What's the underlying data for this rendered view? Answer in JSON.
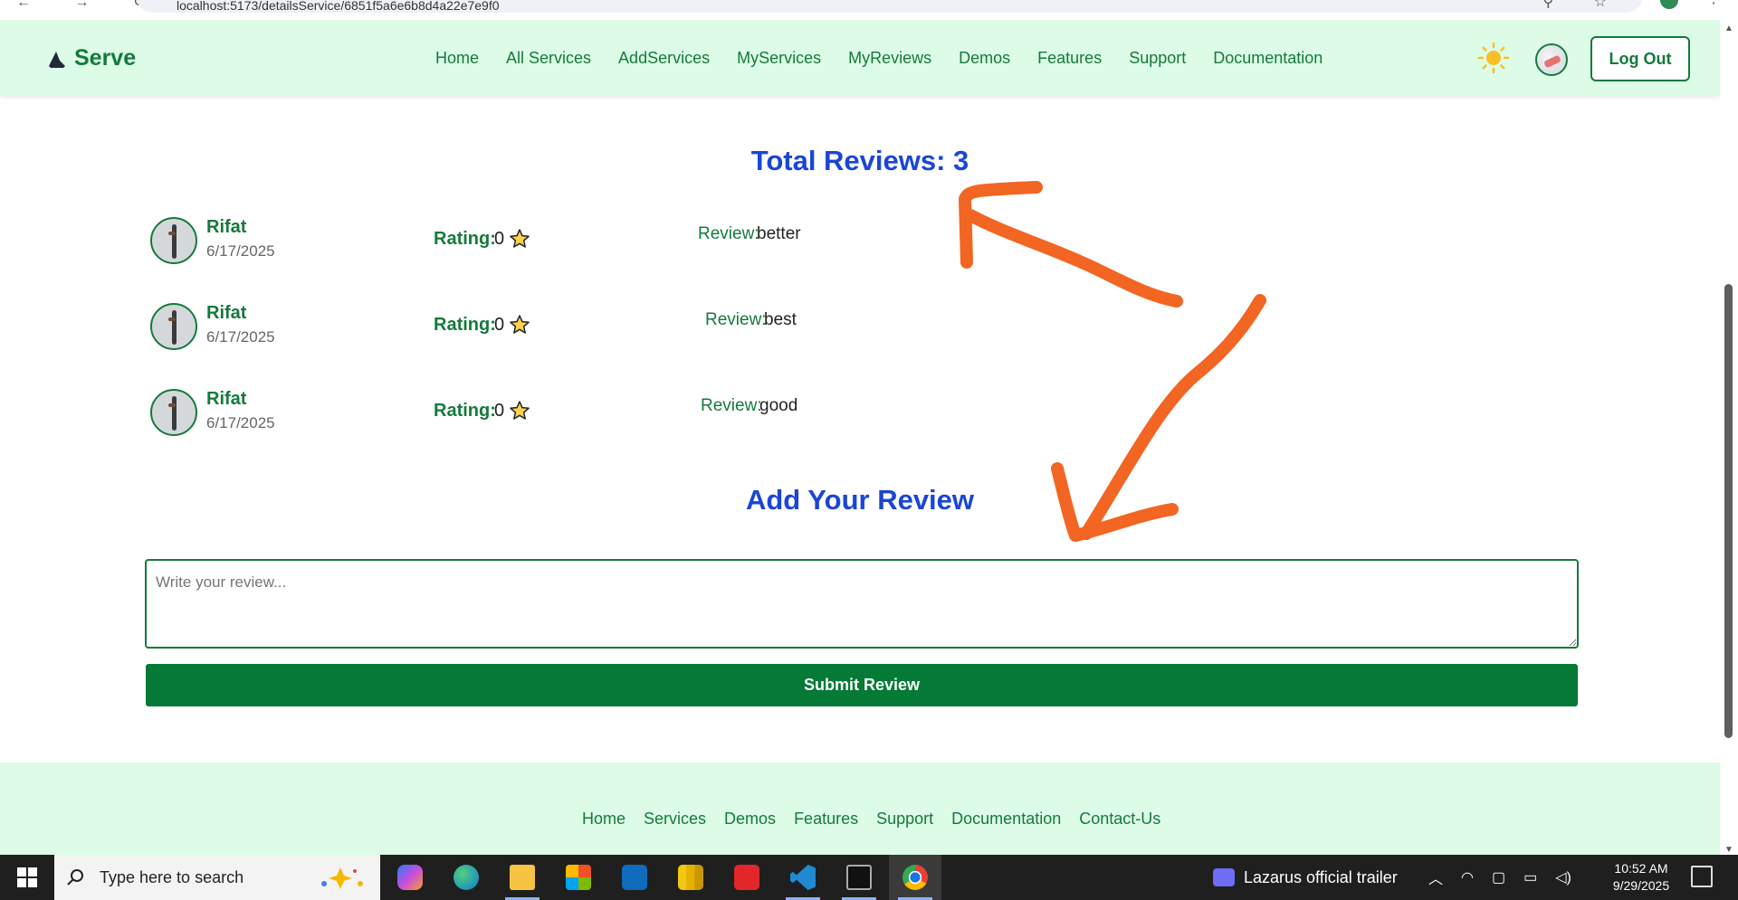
{
  "browser": {
    "url_fragment": "localhost:5173/detailsService/6851f5a6e6b8d4a22e7e9f0",
    "nav_arrows": "← → ↻",
    "url_icons": "⚲ ☆"
  },
  "navbar": {
    "brand": "Serve",
    "links": [
      "Home",
      "All Services",
      "AddServices",
      "MyServices",
      "MyReviews",
      "Demos",
      "Features",
      "Support",
      "Documentation"
    ],
    "logout_label": "Log Out"
  },
  "reviews_section": {
    "title": "Total Reviews: 3",
    "rating_label": "Rating:",
    "review_label": "Review:",
    "items": [
      {
        "name": "Rifat",
        "date": "6/17/2025",
        "rating": "0",
        "review": "better"
      },
      {
        "name": "Rifat",
        "date": "6/17/2025",
        "rating": "0",
        "review": "best"
      },
      {
        "name": "Rifat",
        "date": "6/17/2025",
        "rating": "0",
        "review": "good"
      }
    ]
  },
  "add_review": {
    "title": "Add Your Review",
    "placeholder": "Write your review...",
    "submit_label": "Submit Review"
  },
  "footer": {
    "links": [
      "Home",
      "Services",
      "Demos",
      "Features",
      "Support",
      "Documentation",
      "Contact-Us"
    ]
  },
  "taskbar": {
    "search_placeholder": "Type here to search",
    "media_title": "Lazarus official trailer",
    "time": "10:52 AM",
    "date": "9/29/2025",
    "apps": [
      "copilot",
      "edge",
      "file-explorer",
      "microsoft-store",
      "outlook",
      "power-bi",
      "wps-office",
      "vscode",
      "terminal",
      "chrome"
    ]
  },
  "colors": {
    "brand_green": "#157a3c",
    "nav_background": "#dcfce7",
    "title_blue": "#1a46d6",
    "submit_green": "#047a36",
    "annotation_orange": "#f26522"
  }
}
